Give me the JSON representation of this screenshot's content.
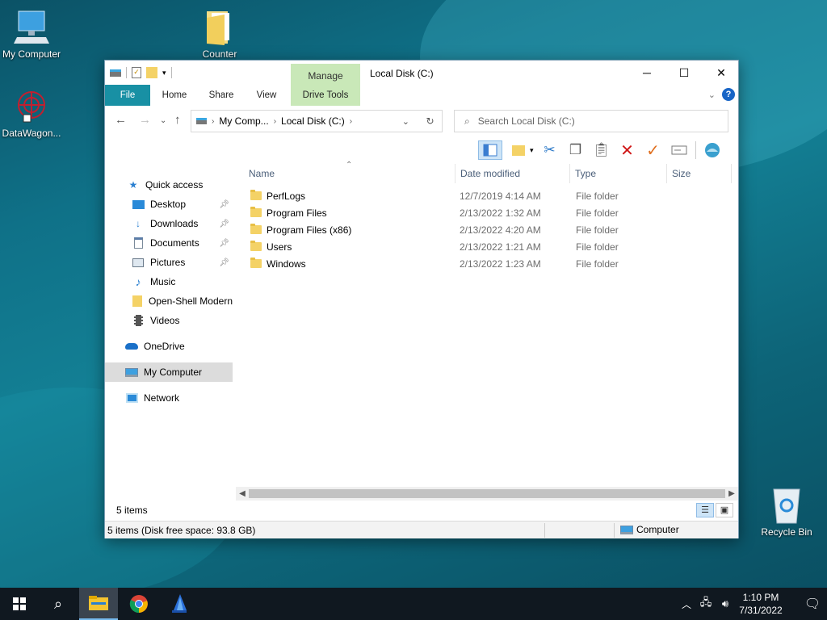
{
  "desktop": {
    "icons": [
      {
        "label": "My Computer"
      },
      {
        "label": "Counter"
      },
      {
        "label": "DataWagon..."
      },
      {
        "label": "Recycle Bin"
      }
    ]
  },
  "window": {
    "title": "Local Disk (C:)",
    "contextual_group": "Manage",
    "ribbon_tabs": [
      "File",
      "Home",
      "Share",
      "View",
      "Drive Tools"
    ],
    "address": {
      "segments": [
        "My Comp...",
        "Local Disk (C:)"
      ]
    },
    "search": {
      "placeholder": "Search Local Disk (C:)"
    },
    "nav_pane": [
      {
        "label": "Quick access",
        "icon": "star-icon"
      },
      {
        "label": "Desktop",
        "icon": "desktop-icon",
        "pinned": true
      },
      {
        "label": "Downloads",
        "icon": "download-icon",
        "pinned": true
      },
      {
        "label": "Documents",
        "icon": "document-icon",
        "pinned": true
      },
      {
        "label": "Pictures",
        "icon": "pictures-icon",
        "pinned": true
      },
      {
        "label": "Music",
        "icon": "music-icon"
      },
      {
        "label": "Open-Shell Modern",
        "icon": "folder-icon"
      },
      {
        "label": "Videos",
        "icon": "video-icon"
      },
      {
        "label": "OneDrive",
        "icon": "cloud-icon"
      },
      {
        "label": "My Computer",
        "icon": "computer-icon",
        "selected": true
      },
      {
        "label": "Network",
        "icon": "network-icon"
      }
    ],
    "columns": [
      "Name",
      "Date modified",
      "Type",
      "Size"
    ],
    "files": [
      {
        "name": "PerfLogs",
        "date": "12/7/2019 4:14 AM",
        "type": "File folder"
      },
      {
        "name": "Program Files",
        "date": "2/13/2022 1:32 AM",
        "type": "File folder"
      },
      {
        "name": "Program Files (x86)",
        "date": "2/13/2022 4:20 AM",
        "type": "File folder"
      },
      {
        "name": "Users",
        "date": "2/13/2022 1:21 AM",
        "type": "File folder"
      },
      {
        "name": "Windows",
        "date": "2/13/2022 1:23 AM",
        "type": "File folder"
      }
    ],
    "item_count": "5 items",
    "status": {
      "left": "5 items (Disk free space: 93.8 GB)",
      "right": "Computer"
    }
  },
  "taskbar": {
    "time": "1:10 PM",
    "date": "7/31/2022"
  },
  "colors": {
    "file_tab": "#1890a4",
    "manage_tab": "#c9e8b8",
    "selection": "#dcdcdc"
  }
}
